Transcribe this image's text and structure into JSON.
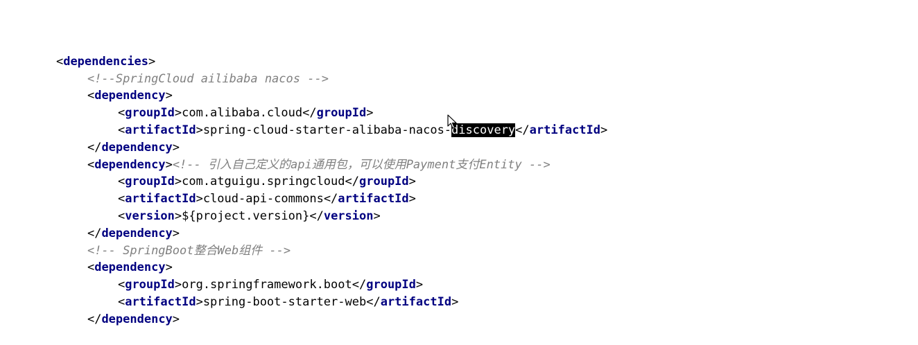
{
  "code": {
    "dependencies_tag": "dependencies",
    "dependency_tag": "dependency",
    "groupId_tag": "groupId",
    "artifactId_tag": "artifactId",
    "version_tag": "version",
    "comment_nacos": "<!--SpringCloud ailibaba nacos -->",
    "nacos_group": "com.alibaba.cloud",
    "nacos_artifact_prefix": "spring-cloud-starter-alibaba-nacos-",
    "nacos_artifact_selected": "discovery",
    "comment_commons": "<!-- 引入自己定义的api通用包，可以使用Payment支付Entity -->",
    "commons_group": "com.atguigu.springcloud",
    "commons_artifact": "cloud-api-commons",
    "commons_version": "${project.version}",
    "comment_web": "<!-- SpringBoot整合Web组件 -->",
    "web_group": "org.springframework.boot",
    "web_artifact": "spring-boot-starter-web"
  },
  "colors": {
    "tag": "#000080",
    "comment": "#808080",
    "selection_bg": "#000000",
    "selection_fg": "#ffffff"
  },
  "icons": {
    "cursor": "mouse-pointer-icon"
  }
}
